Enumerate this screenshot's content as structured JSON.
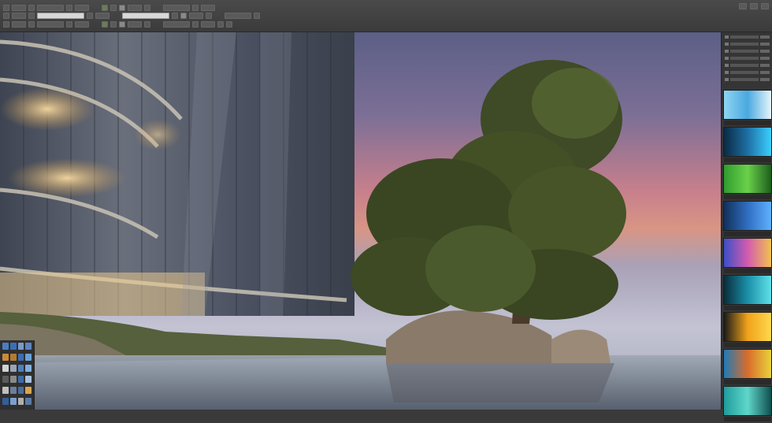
{
  "toolbar": {
    "row1": [
      "tool",
      "tool",
      "tool",
      "tool",
      "tool",
      "tool",
      "tool",
      "tool",
      "tool",
      "tool",
      "tool",
      "tool",
      "tool",
      "tool"
    ],
    "row2": [
      "tool",
      "tool",
      "tool",
      "field",
      "tool",
      "tool",
      "field",
      "tool",
      "tool",
      "tool",
      "tool",
      "tool",
      "tool"
    ],
    "row3": [
      "tool",
      "tool",
      "tool",
      "tool",
      "tool",
      "tool",
      "tool",
      "tool",
      "tool",
      "tool",
      "tool",
      "tool",
      "tool",
      "tool",
      "tool",
      "tool"
    ],
    "window_controls": [
      "min",
      "max",
      "close"
    ]
  },
  "canvas": {
    "scene": "building-and-tree-render"
  },
  "left_panel": {
    "swatches": [
      "#4a7dbf",
      "#3c6fb0",
      "#7a9ac7",
      "#5a86c2",
      "#c98b3a",
      "#b57a2f",
      "#3a6db5",
      "#6aa0d8",
      "#d2d2d2",
      "#9aa4b5",
      "#4e7fbf",
      "#7fb0e0",
      "#5b5b5b",
      "#8a8a8a",
      "#3f6aa8",
      "#a7c2df",
      "#c0c0c0",
      "#6b7f99",
      "#4a6d9b",
      "#d9a44f",
      "#345e9a",
      "#7c9fcf",
      "#b0b0b0",
      "#5a7ba8"
    ]
  },
  "right_panel": {
    "thumbnails": [
      {
        "name": "thumb-ice",
        "colors": [
          "#8fd6f2",
          "#4aa8e0",
          "#e6f6fb"
        ]
      },
      {
        "name": "thumb-circuit",
        "colors": [
          "#0b2a44",
          "#1e6fa3",
          "#3ad0ff"
        ]
      },
      {
        "name": "thumb-green",
        "colors": [
          "#2f9c2f",
          "#6ad14a",
          "#1c5e1c"
        ]
      },
      {
        "name": "thumb-blue-grid",
        "colors": [
          "#12305a",
          "#2f6ec0",
          "#5fb1ff"
        ]
      },
      {
        "name": "thumb-spectrum",
        "colors": [
          "#3b4fc7",
          "#d35bb0",
          "#f2c14e"
        ]
      },
      {
        "name": "thumb-wave",
        "colors": [
          "#0a2c3a",
          "#1a8fa8",
          "#5fe1e8"
        ]
      },
      {
        "name": "thumb-sunset",
        "colors": [
          "#1a1a1a",
          "#f0a21a",
          "#ffd84d"
        ]
      },
      {
        "name": "thumb-bars",
        "colors": [
          "#1f7ab8",
          "#d96c2c",
          "#e8d23a"
        ]
      },
      {
        "name": "thumb-teal",
        "colors": [
          "#1f9c9c",
          "#5fd6c9",
          "#0f4f4f"
        ]
      }
    ]
  }
}
